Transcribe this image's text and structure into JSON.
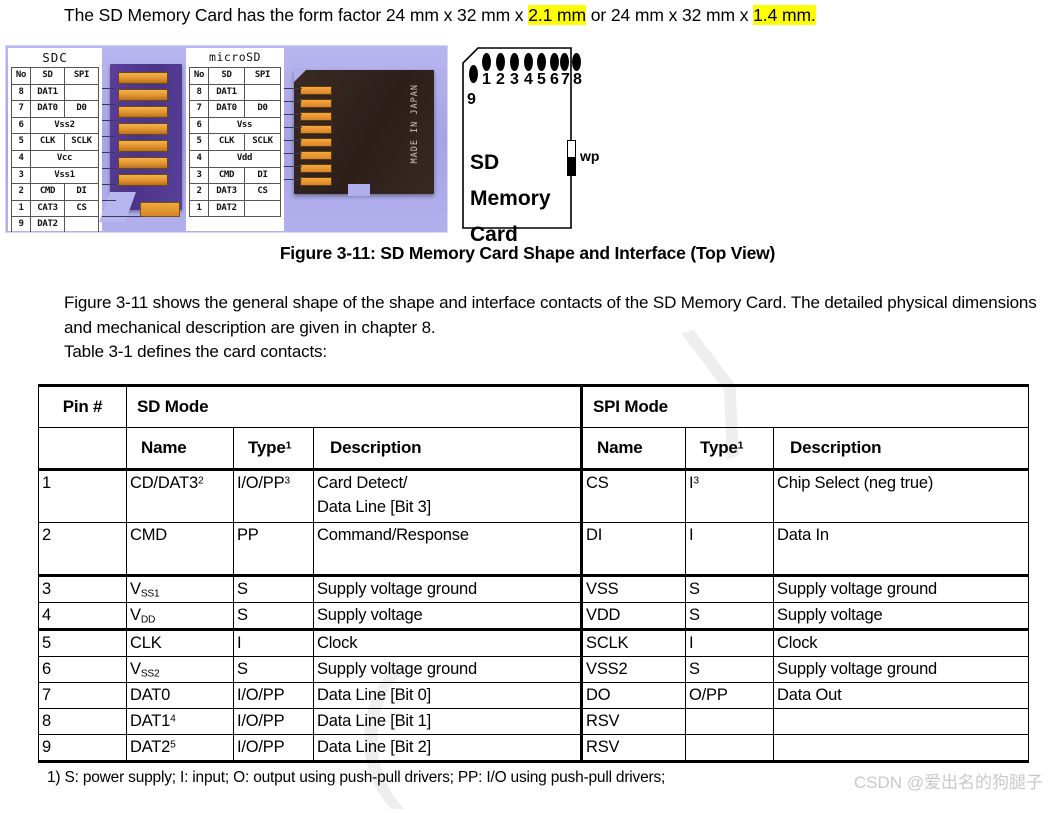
{
  "intro": {
    "part1": "The SD Memory Card has the form factor 24 mm x 32 mm x ",
    "highlight1": "2.1 mm",
    "part2": " or 24 mm x 32 mm x ",
    "highlight2": "1.4 mm.",
    "highlight_color": "#ffff00"
  },
  "figure": {
    "sdc_legend": {
      "title": "SDC",
      "columns": [
        "No",
        "SD",
        "SPI"
      ],
      "rows": [
        {
          "no": "8",
          "sd": "DAT1",
          "spi": ""
        },
        {
          "no": "7",
          "sd": "DAT0",
          "spi": "D0"
        },
        {
          "no": "6",
          "sd": "Vss2",
          "spi": "",
          "span": true
        },
        {
          "no": "5",
          "sd": "CLK",
          "spi": "SCLK"
        },
        {
          "no": "4",
          "sd": "Vcc",
          "spi": "",
          "span": true
        },
        {
          "no": "3",
          "sd": "Vss1",
          "spi": "",
          "span": true
        },
        {
          "no": "2",
          "sd": "CMD",
          "spi": "DI"
        },
        {
          "no": "1",
          "sd": "CAT3",
          "spi": "CS"
        },
        {
          "no": "9",
          "sd": "DAT2",
          "spi": ""
        }
      ]
    },
    "microsd_legend": {
      "title": "microSD",
      "columns": [
        "No",
        "SD",
        "SPI"
      ],
      "rows": [
        {
          "no": "8",
          "sd": "DAT1",
          "spi": ""
        },
        {
          "no": "7",
          "sd": "DAT0",
          "spi": "D0"
        },
        {
          "no": "6",
          "sd": "Vss",
          "spi": "",
          "span": true
        },
        {
          "no": "5",
          "sd": "CLK",
          "spi": "SCLK"
        },
        {
          "no": "4",
          "sd": "Vdd",
          "spi": "",
          "span": true
        },
        {
          "no": "3",
          "sd": "CMD",
          "spi": "DI"
        },
        {
          "no": "2",
          "sd": "DAT3",
          "spi": "CS"
        },
        {
          "no": "1",
          "sd": "DAT2",
          "spi": ""
        }
      ]
    },
    "microsd_photo_text": "MADE IN JAPAN",
    "card_drawing": {
      "pin_numbers": [
        "1",
        "2",
        "3",
        "4",
        "5",
        "6",
        "7",
        "8"
      ],
      "pin9_number": "9",
      "label_line1": "SD Memory",
      "label_line2": "Card",
      "wp_label": "wp"
    },
    "caption": "Figure 3-11: SD Memory Card Shape and Interface (Top View)"
  },
  "body": {
    "paragraph1": "Figure 3-11 shows the general shape of the shape and interface contacts of the SD Memory Card. The detailed physical dimensions and mechanical description are given in chapter 8.",
    "paragraph2": "Table 3-1 defines the card contacts:"
  },
  "table": {
    "headers": {
      "pin": "Pin #",
      "sd_mode": "SD Mode",
      "spi_mode": "SPI Mode",
      "name": "Name",
      "type": "Type",
      "type_sup": "1",
      "description": "Description"
    },
    "rows": [
      {
        "pin": "1",
        "sd_name": "CD/DAT3",
        "sd_name_sup": "2",
        "sd_type": "I/O/PP",
        "sd_type_sup": "3",
        "sd_desc_line1": "Card Detect/",
        "sd_desc_line2": "Data Line [Bit 3]",
        "spi_name": "CS",
        "spi_type": "I",
        "spi_type_sup": "3",
        "spi_desc": "Chip Select (neg true)"
      },
      {
        "pin": "2",
        "sd_name": "CMD",
        "sd_name_sup": "",
        "sd_type": "PP",
        "sd_type_sup": "",
        "sd_desc_line1": "Command/Response",
        "sd_desc_line2": "",
        "spi_name": "DI",
        "spi_type": "I",
        "spi_type_sup": "",
        "spi_desc": "Data In"
      },
      {
        "pin": "3",
        "sd_name": "V",
        "sd_name_sub": "SS1",
        "sd_type": "S",
        "sd_type_sup": "",
        "sd_desc_line1": "Supply voltage ground",
        "sd_desc_line2": "",
        "spi_name": "VSS",
        "spi_type": "S",
        "spi_type_sup": "",
        "spi_desc": "Supply voltage ground"
      },
      {
        "pin": "4",
        "sd_name": "V",
        "sd_name_sub": "DD",
        "sd_type": "S",
        "sd_type_sup": "",
        "sd_desc_line1": "Supply voltage",
        "sd_desc_line2": "",
        "spi_name": "VDD",
        "spi_type": "S",
        "spi_type_sup": "",
        "spi_desc": "Supply voltage"
      },
      {
        "pin": "5",
        "sd_name": "CLK",
        "sd_name_sub": "",
        "sd_type": "I",
        "sd_type_sup": "",
        "sd_desc_line1": "Clock",
        "sd_desc_line2": "",
        "spi_name": "SCLK",
        "spi_type": "I",
        "spi_type_sup": "",
        "spi_desc": "Clock"
      },
      {
        "pin": "6",
        "sd_name": "V",
        "sd_name_sub": "SS2",
        "sd_type": "S",
        "sd_type_sup": "",
        "sd_desc_line1": "Supply voltage ground",
        "sd_desc_line2": "",
        "spi_name": "VSS2",
        "spi_type": "S",
        "spi_type_sup": "",
        "spi_desc": "Supply voltage ground"
      },
      {
        "pin": "7",
        "sd_name": "DAT0",
        "sd_name_sup": "",
        "sd_type": "I/O/PP",
        "sd_type_sup": "",
        "sd_desc_line1": "Data Line [Bit 0]",
        "sd_desc_line2": "",
        "spi_name": "DO",
        "spi_type": "O/PP",
        "spi_type_sup": "",
        "spi_desc": "Data Out"
      },
      {
        "pin": "8",
        "sd_name": "DAT1",
        "sd_name_sup": "4",
        "sd_type": "I/O/PP",
        "sd_type_sup": "",
        "sd_desc_line1": "Data Line [Bit 1]",
        "sd_desc_line2": "",
        "spi_name": "RSV",
        "spi_type": "",
        "spi_type_sup": "",
        "spi_desc": ""
      },
      {
        "pin": "9",
        "sd_name": "DAT2",
        "sd_name_sup": "5",
        "sd_type": "I/O/PP",
        "sd_type_sup": "",
        "sd_desc_line1": "Data Line [Bit 2]",
        "sd_desc_line2": "",
        "spi_name": "RSV",
        "spi_type": "",
        "spi_type_sup": "",
        "spi_desc": ""
      }
    ]
  },
  "footnote": "1) S: power supply; I: input; O: output using push-pull drivers; PP: I/O using push-pull drivers;",
  "watermark": "CSDN @爱出名的狗腿子"
}
